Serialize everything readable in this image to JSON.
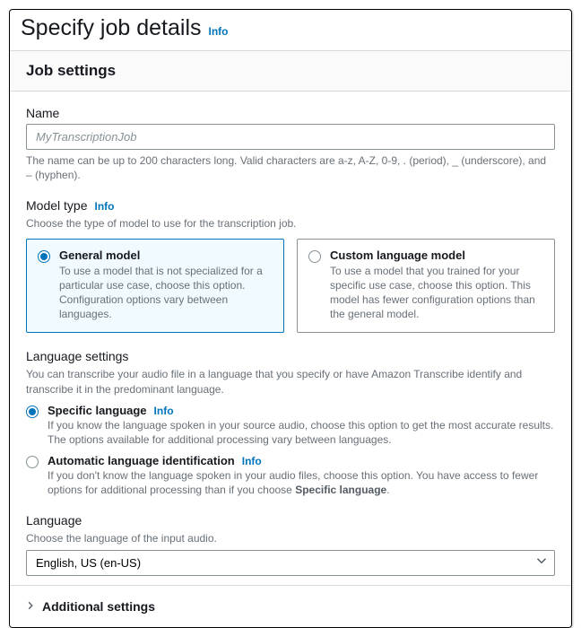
{
  "page": {
    "title": "Specify job details",
    "info": "Info"
  },
  "panel": {
    "title": "Job settings"
  },
  "name": {
    "label": "Name",
    "placeholder": "MyTranscriptionJob",
    "hint": "The name can be up to 200 characters long. Valid characters are a-z, A-Z, 0-9, . (period), _ (underscore), and – (hyphen)."
  },
  "model_type": {
    "label": "Model type",
    "info": "Info",
    "desc": "Choose the type of model to use for the transcription job.",
    "options": [
      {
        "title": "General model",
        "desc": "To use a model that is not specialized for a particular use case, choose this option. Configuration options vary between languages.",
        "selected": true
      },
      {
        "title": "Custom language model",
        "desc": "To use a model that you trained for your specific use case, choose this option. This model has fewer configuration options than the general model.",
        "selected": false
      }
    ]
  },
  "language_settings": {
    "label": "Language settings",
    "desc": "You can transcribe your audio file in a language that you specify or have Amazon Transcribe identify and transcribe it in the predominant language.",
    "info": "Info",
    "options": [
      {
        "title": "Specific language",
        "desc": "If you know the language spoken in your source audio, choose this option to get the most accurate results. The options available for additional processing vary between languages.",
        "selected": true
      },
      {
        "title": "Automatic language identification",
        "desc_pre": "If you don't know the language spoken in your audio files, choose this option. You have access to fewer options for additional processing than if you choose ",
        "desc_bold": "Specific language",
        "desc_post": ".",
        "selected": false
      }
    ]
  },
  "language": {
    "label": "Language",
    "desc": "Choose the language of the input audio.",
    "value": "English, US (en-US)"
  },
  "additional": {
    "title": "Additional settings"
  }
}
